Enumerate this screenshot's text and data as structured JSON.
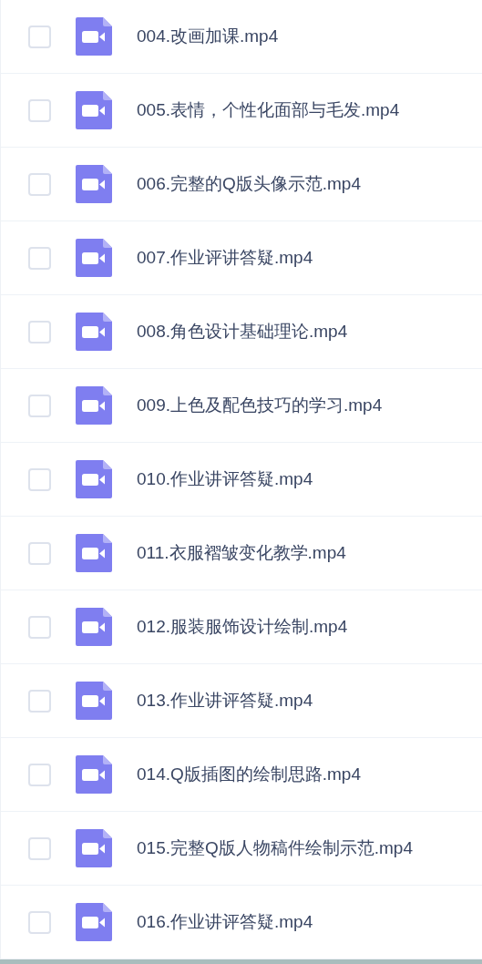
{
  "files": [
    {
      "name": "004.改画加课.mp4",
      "checked": false
    },
    {
      "name": "005.表情，个性化面部与毛发.mp4",
      "checked": false
    },
    {
      "name": "006.完整的Q版头像示范.mp4",
      "checked": false
    },
    {
      "name": "007.作业评讲答疑.mp4",
      "checked": false
    },
    {
      "name": "008.角色设计基础理论.mp4",
      "checked": false
    },
    {
      "name": "009.上色及配色技巧的学习.mp4",
      "checked": false
    },
    {
      "name": "010.作业讲评答疑.mp4",
      "checked": false
    },
    {
      "name": "011.衣服褶皱变化教学.mp4",
      "checked": false
    },
    {
      "name": "012.服装服饰设计绘制.mp4",
      "checked": false
    },
    {
      "name": "013.作业讲评答疑.mp4",
      "checked": false
    },
    {
      "name": "014.Q版插图的绘制思路.mp4",
      "checked": false
    },
    {
      "name": "015.完整Q版人物稿件绘制示范.mp4",
      "checked": false
    },
    {
      "name": "016.作业讲评答疑.mp4",
      "checked": false
    }
  ]
}
